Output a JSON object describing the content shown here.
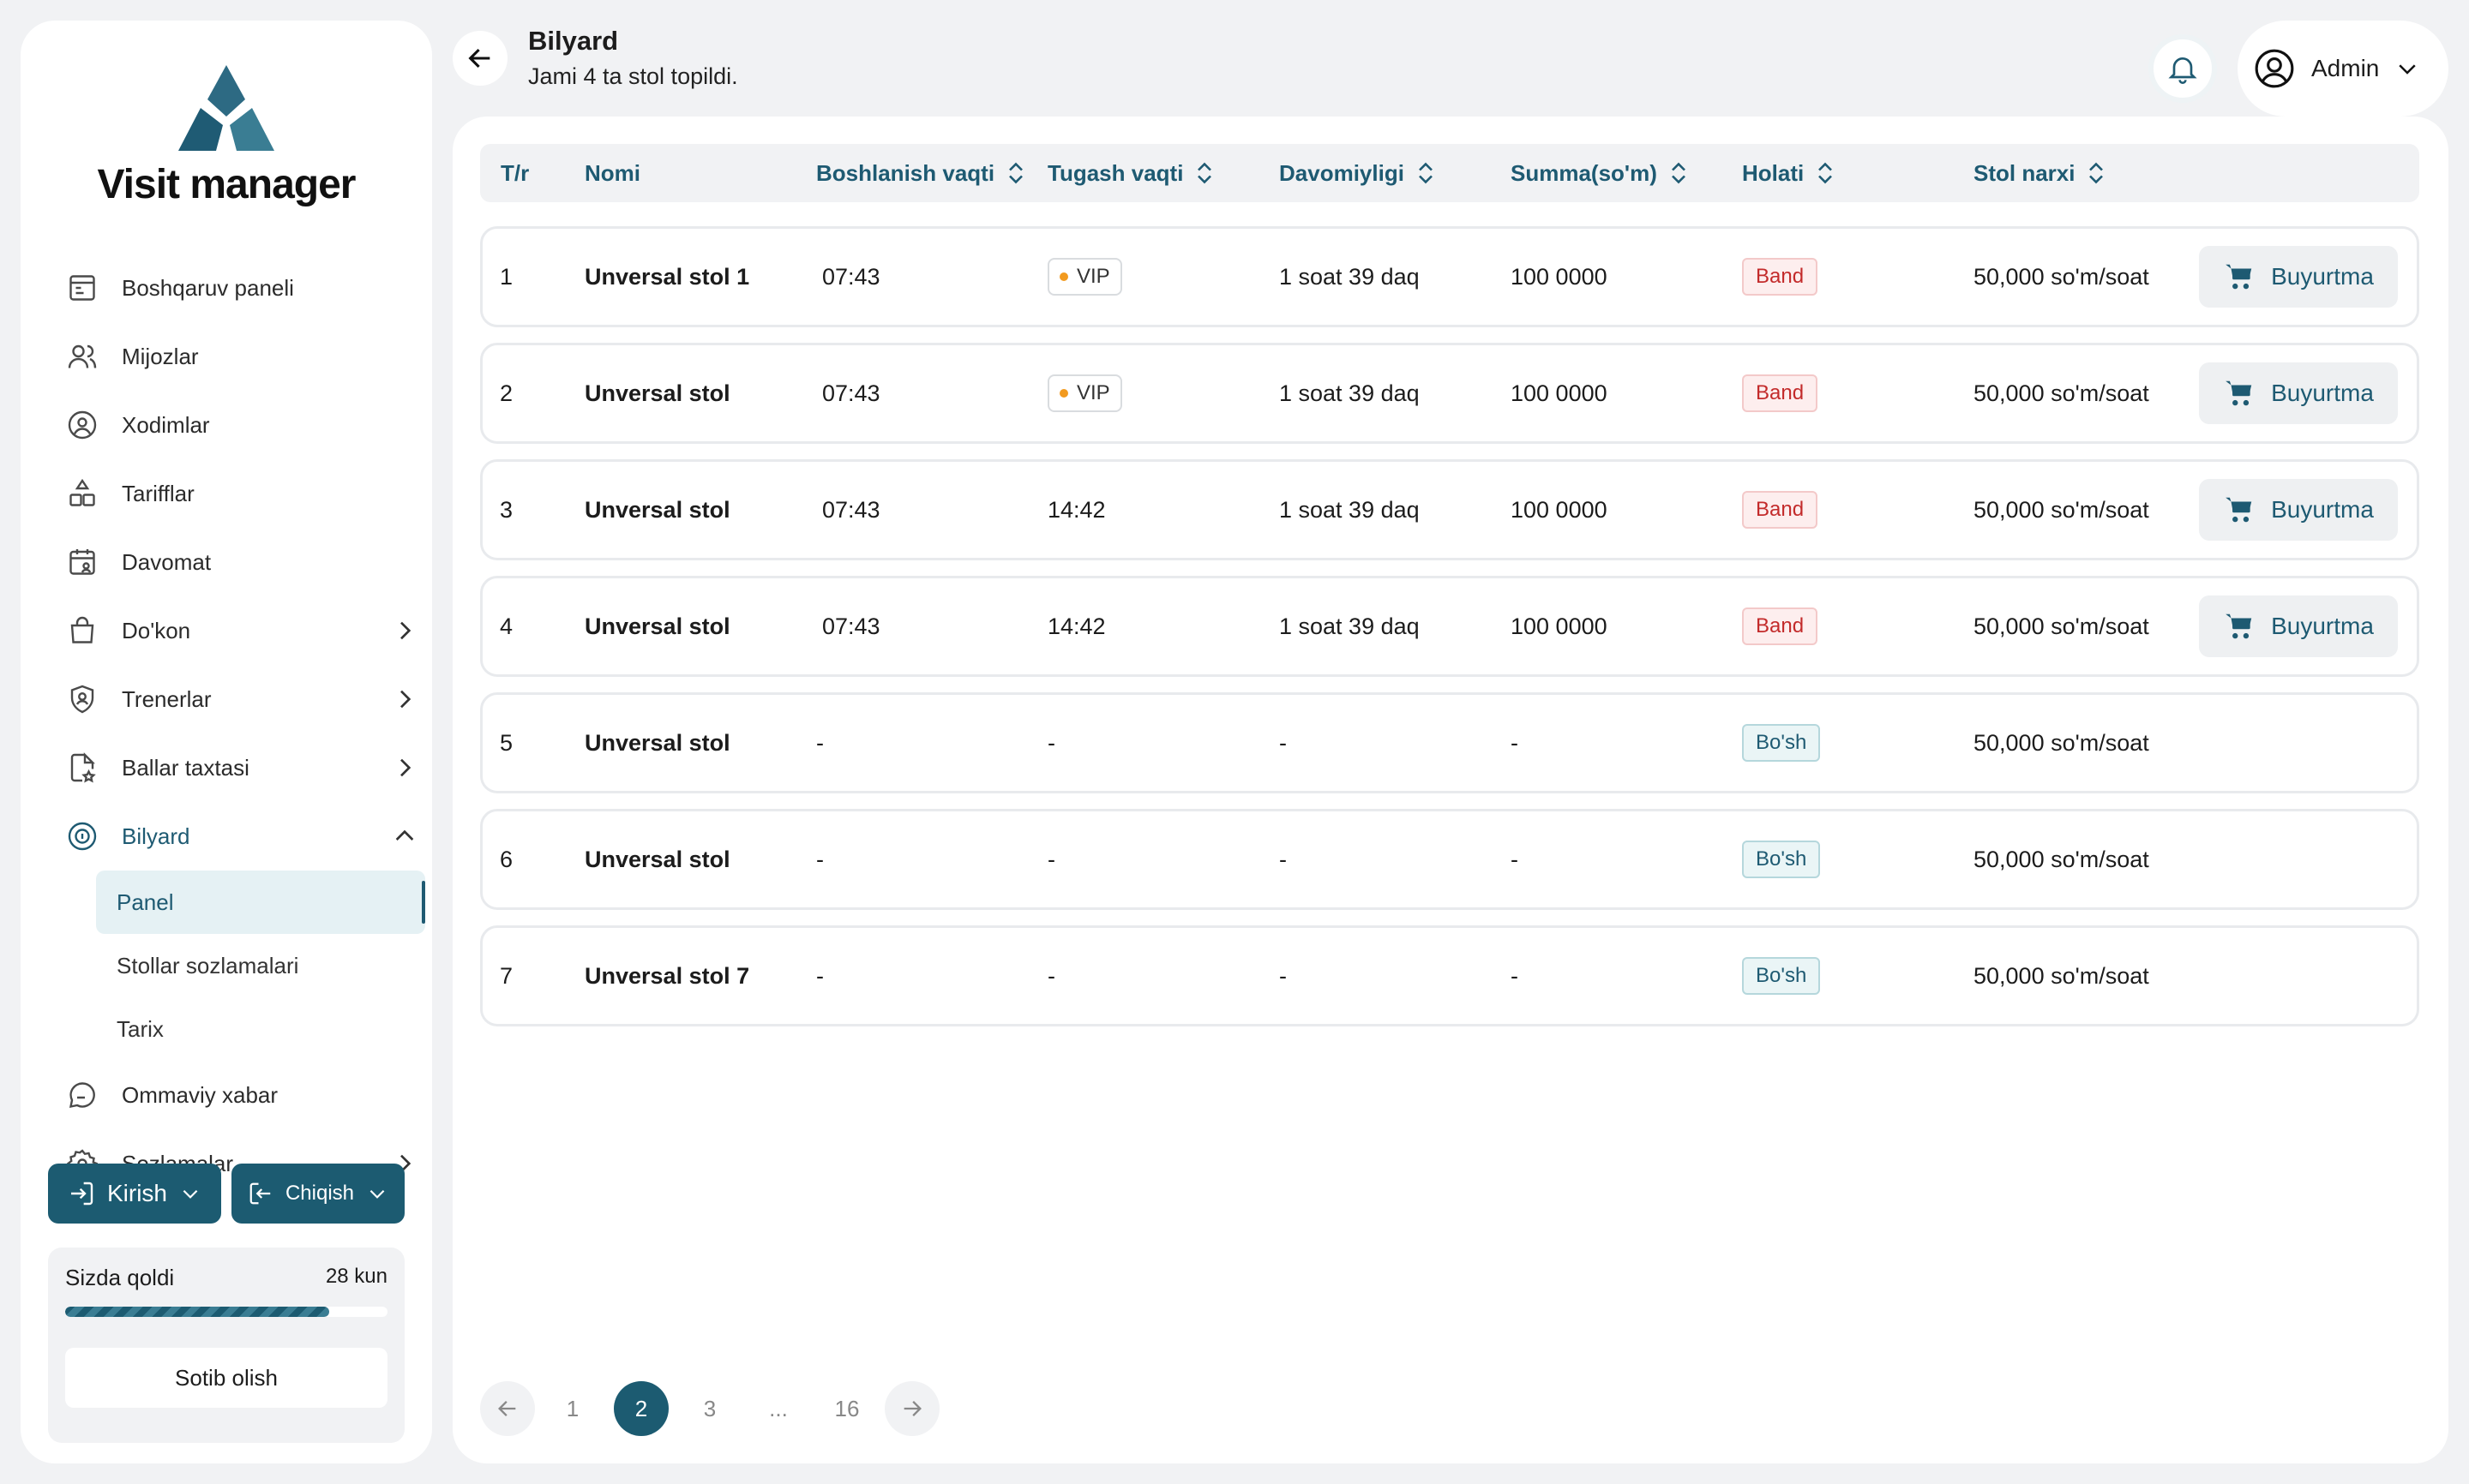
{
  "app": {
    "name": "Visit manager"
  },
  "sidebar": {
    "items": [
      {
        "label": "Boshqaruv paneli",
        "icon": "dashboard-icon"
      },
      {
        "label": "Mijozlar",
        "icon": "users-icon"
      },
      {
        "label": "Xodimlar",
        "icon": "staff-icon"
      },
      {
        "label": "Tarifflar",
        "icon": "shapes-icon"
      },
      {
        "label": "Davomat",
        "icon": "calendar-user-icon"
      },
      {
        "label": "Do'kon",
        "icon": "shopping-bag-icon"
      },
      {
        "label": "Trenerlar",
        "icon": "shield-user-icon"
      },
      {
        "label": "Ballar taxtasi",
        "icon": "file-star-icon"
      },
      {
        "label": "Bilyard",
        "icon": "billiard-ball-icon"
      },
      {
        "label": "Ommaviy xabar",
        "icon": "chat-icon"
      },
      {
        "label": "Sozlamalar",
        "icon": "gear-icon"
      }
    ],
    "submenu": [
      "Panel",
      "Stollar sozlamalari",
      "Tarix"
    ],
    "enter_label": "Kirish",
    "exit_label": "Chiqish",
    "plan": {
      "label": "Sizda qoldi",
      "days": "28 kun",
      "progress": 0.82,
      "buy_label": "Sotib olish"
    }
  },
  "header": {
    "title": "Bilyard",
    "subtitle": "Jami 4 ta stol topildi.",
    "user": "Admin"
  },
  "table": {
    "columns": [
      "T/r",
      "Nomi",
      "Boshlanish vaqti",
      "Tugash vaqti",
      "Davomiyligi",
      "Summa(so'm)",
      "Holati",
      "Stol narxi"
    ],
    "order_label": "Buyurtma",
    "rows": [
      {
        "n": "1",
        "name": "Unversal stol 1",
        "start": "07:43",
        "end": "VIP",
        "duration": "1 soat 39 daq",
        "sum": "100 0000",
        "status": "Band",
        "price": "50,000 so'm/soat"
      },
      {
        "n": "2",
        "name": "Unversal stol",
        "start": "07:43",
        "end": "VIP",
        "duration": "1 soat 39 daq",
        "sum": "100 0000",
        "status": "Band",
        "price": "50,000 so'm/soat"
      },
      {
        "n": "3",
        "name": "Unversal stol",
        "start": "07:43",
        "end": "14:42",
        "duration": "1 soat 39 daq",
        "sum": "100 0000",
        "status": "Band",
        "price": "50,000 so'm/soat"
      },
      {
        "n": "4",
        "name": "Unversal stol",
        "start": "07:43",
        "end": "14:42",
        "duration": "1 soat 39 daq",
        "sum": "100 0000",
        "status": "Band",
        "price": "50,000 so'm/soat"
      },
      {
        "n": "5",
        "name": "Unversal stol",
        "start": "-",
        "end": "-",
        "duration": "-",
        "sum": "-",
        "status": "Bo'sh",
        "price": "50,000 so'm/soat"
      },
      {
        "n": "6",
        "name": "Unversal stol",
        "start": "-",
        "end": "-",
        "duration": "-",
        "sum": "-",
        "status": "Bo'sh",
        "price": "50,000 so'm/soat"
      },
      {
        "n": "7",
        "name": "Unversal stol 7",
        "start": "-",
        "end": "-",
        "duration": "-",
        "sum": "-",
        "status": "Bo'sh",
        "price": "50,000 so'm/soat"
      }
    ]
  },
  "pagination": {
    "pages": [
      "1",
      "2",
      "3",
      "...",
      "16"
    ],
    "current": "2"
  },
  "colors": {
    "primary": "#1c5b71",
    "band": "#c32b2b",
    "vip_dot": "#f29a1f"
  }
}
